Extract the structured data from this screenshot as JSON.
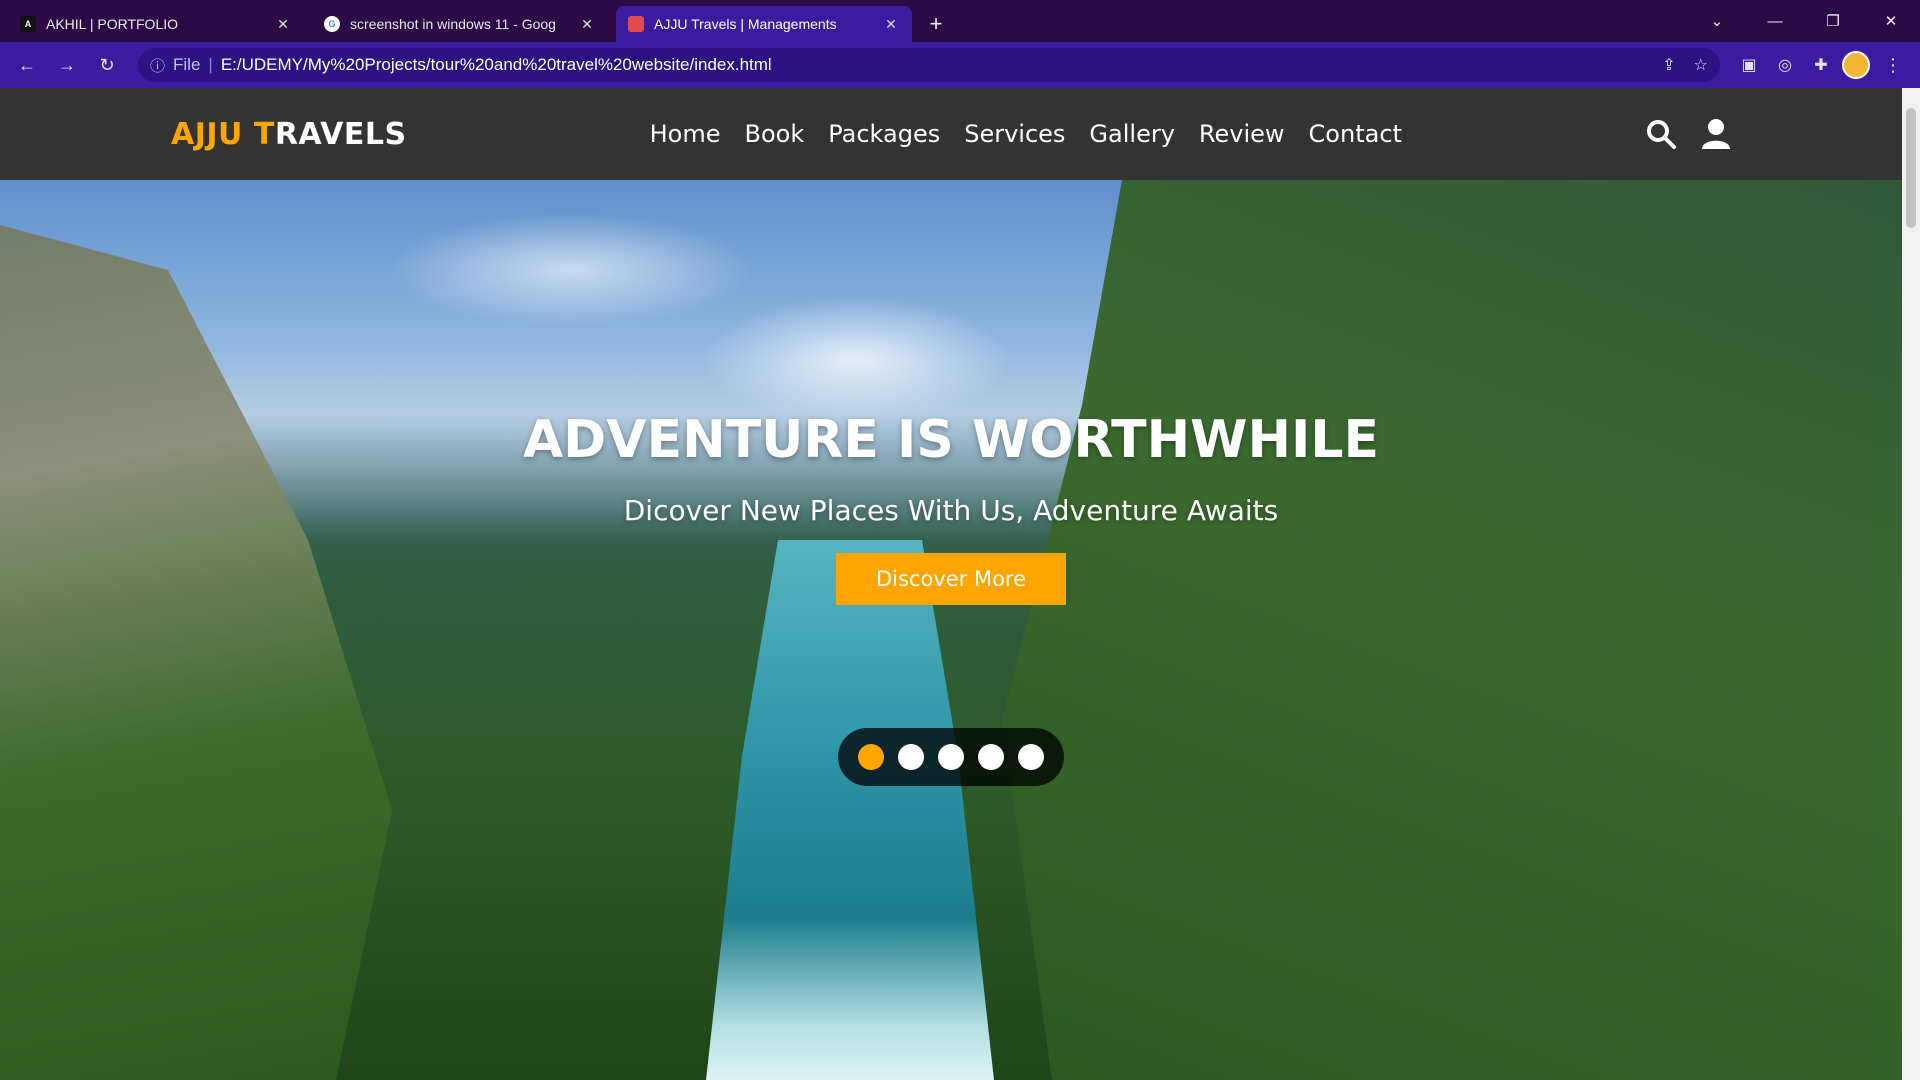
{
  "browser": {
    "tabs": [
      {
        "title": "AKHIL | PORTFOLIO",
        "favicon": "A",
        "active": false
      },
      {
        "title": "screenshot in windows 11 - Goog",
        "favicon": "G",
        "active": false
      },
      {
        "title": "AJJU Travels | Managements",
        "favicon": "",
        "active": true
      }
    ],
    "new_tab_icon": "plus-icon",
    "address": {
      "info_icon": "info-icon",
      "scheme": "File",
      "url": "E:/UDEMY/My%20Projects/tour%20and%20travel%20website/index.html"
    }
  },
  "site": {
    "logo_primary": "AJJU",
    "logo_accent_letter": "T",
    "logo_rest": "RAVELS",
    "nav": [
      "Home",
      "Book",
      "Packages",
      "Services",
      "Gallery",
      "Review",
      "Contact"
    ],
    "hero": {
      "title": "ADVENTURE IS WORTHWHILE",
      "subtitle": "Dicover New Places With Us, Adventure Awaits",
      "cta": "Discover More"
    },
    "slider": {
      "count": 5,
      "active_index": 0
    }
  },
  "colors": {
    "accent": "#ffa500",
    "header_bg": "#333333",
    "tab_bar": "#2b0a45",
    "toolbar": "#3b1c9e"
  }
}
